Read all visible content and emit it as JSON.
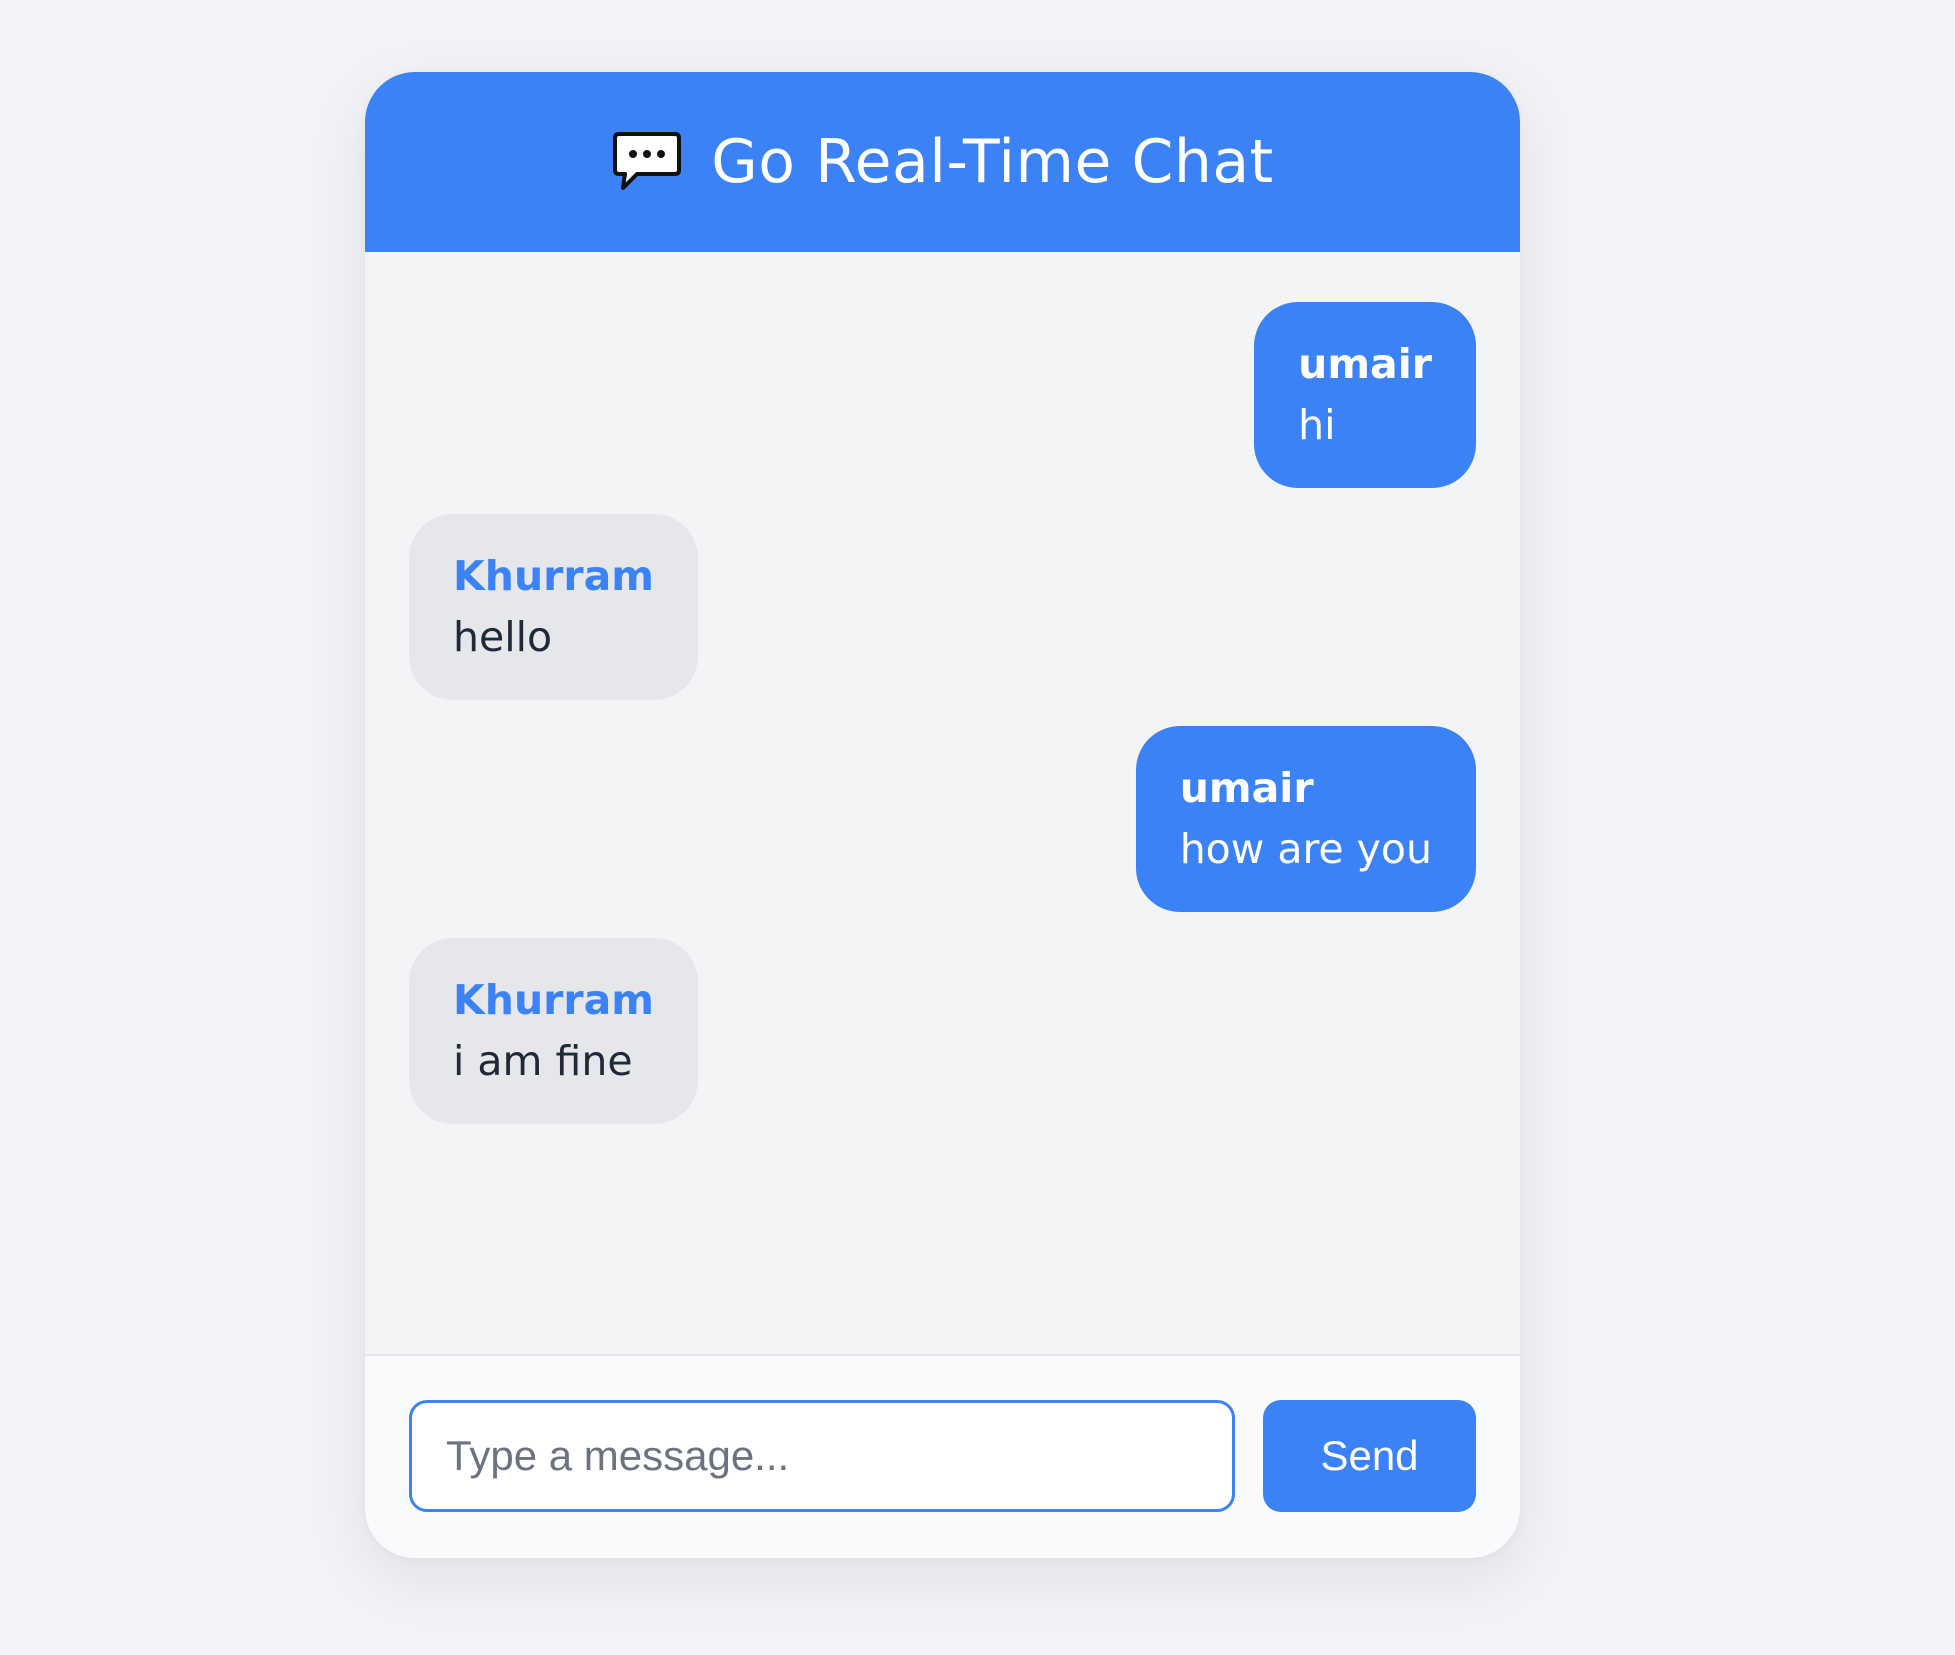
{
  "app": {
    "title": "Go Real-Time Chat",
    "header_icon": "speech-bubble-icon"
  },
  "messages": [
    {
      "sender": "umair",
      "text": "hi",
      "own": true
    },
    {
      "sender": "Khurram",
      "text": "hello",
      "own": false
    },
    {
      "sender": "umair",
      "text": "how are you",
      "own": true
    },
    {
      "sender": "Khurram",
      "text": "i am fine",
      "own": false
    }
  ],
  "composer": {
    "placeholder": "Type a message...",
    "value": "",
    "send_label": "Send"
  },
  "colors": {
    "accent": "#3b82f6",
    "page_background": "#f2f3f6",
    "incoming_bubble": "#e5e7eb",
    "incoming_text": "#1f2937",
    "outgoing_text": "#ffffff"
  }
}
